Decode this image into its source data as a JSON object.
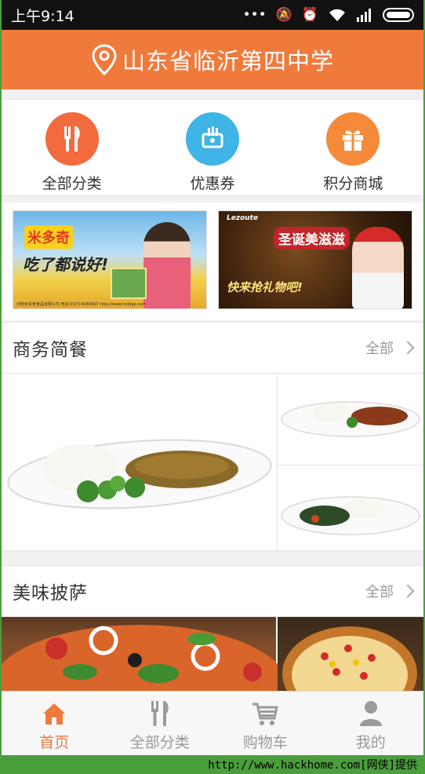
{
  "statusbar": {
    "time": "上午9:14",
    "icons": [
      "dots-icon",
      "mute-icon",
      "alarm-icon",
      "wifi-icon",
      "signal-icon",
      "battery-icon"
    ]
  },
  "header": {
    "location": "山东省临沂第四中学",
    "icon": "location-pin-icon"
  },
  "quick_entries": [
    {
      "label": "全部分类",
      "icon": "fork-knife-icon",
      "color": "#f26a3d"
    },
    {
      "label": "优惠券",
      "icon": "coupon-icon",
      "color": "#3fb4e6"
    },
    {
      "label": "积分商城",
      "icon": "gift-icon",
      "color": "#f58a3a"
    }
  ],
  "banners": [
    {
      "text_a": "米多奇",
      "text_b": "吃了都说好!",
      "footer": "河南米多奇食品有限公司  电话:0373-6080697  http://www.midqqi.com"
    },
    {
      "brand": "Lezoute",
      "text_a": "圣诞美滋滋",
      "text_b": "快来抢礼物吧!"
    }
  ],
  "sections": [
    {
      "title": "商务简餐",
      "more": "全部"
    },
    {
      "title": "美味披萨",
      "more": "全部"
    }
  ],
  "tabbar": [
    {
      "label": "首页",
      "icon": "home-icon",
      "active": true
    },
    {
      "label": "全部分类",
      "icon": "fork-knife-icon",
      "active": false
    },
    {
      "label": "购物车",
      "icon": "cart-icon",
      "active": false
    },
    {
      "label": "我的",
      "icon": "user-icon",
      "active": false
    }
  ],
  "colors": {
    "accent": "#f07a3c",
    "inactive": "#9a9a9a"
  },
  "watermark": "http://www.hackhome.com[网侠]提供"
}
